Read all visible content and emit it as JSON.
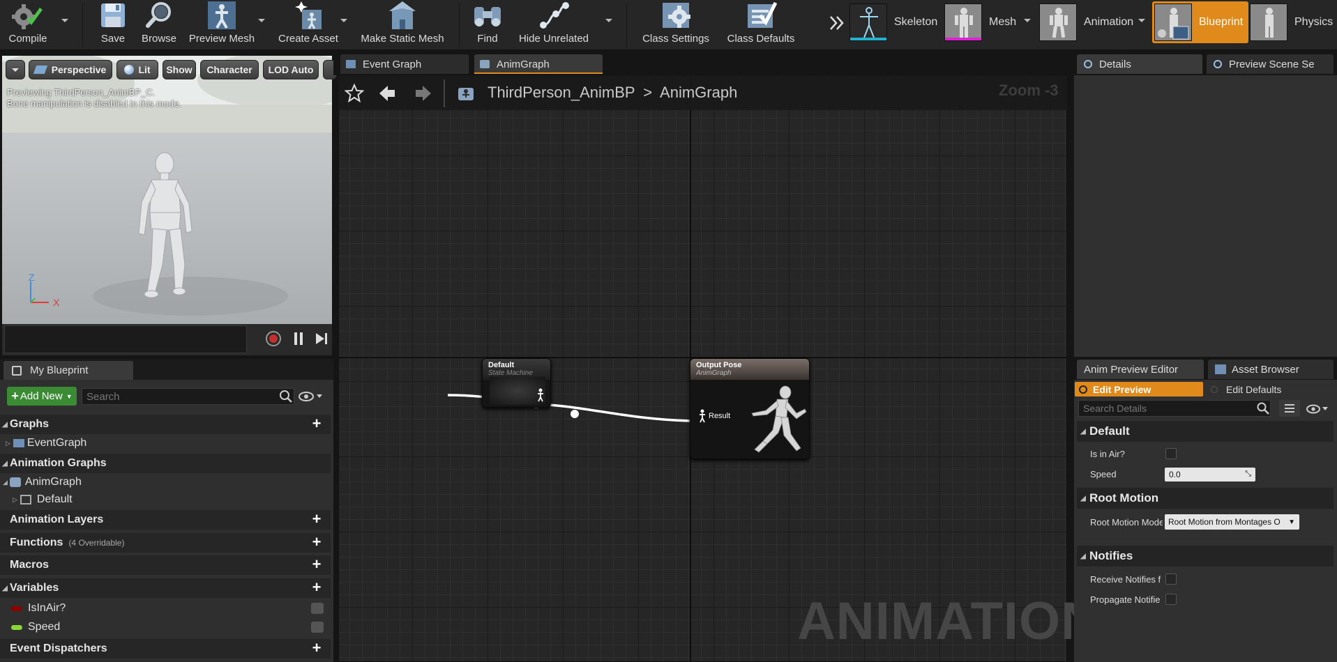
{
  "toolbar": {
    "compile": "Compile",
    "save": "Save",
    "browse": "Browse",
    "preview_mesh": "Preview Mesh",
    "create_asset": "Create Asset",
    "make_static_mesh": "Make Static Mesh",
    "find": "Find",
    "hide_unrelated": "Hide Unrelated",
    "class_settings": "Class Settings",
    "class_defaults": "Class Defaults"
  },
  "modes": {
    "skeleton": "Skeleton",
    "mesh": "Mesh",
    "animation": "Animation",
    "blueprint": "Blueprint",
    "physics": "Physics",
    "active": "Blueprint"
  },
  "viewport": {
    "perspective": "Perspective",
    "lit": "Lit",
    "show": "Show",
    "character": "Character",
    "lod": "LOD Auto",
    "message_line1": "Previewing ThirdPerson_AnimBP_C.",
    "message_line2": "Bone manipulation is disabled in this mode.",
    "axis_z": "Z",
    "axis_x": "X"
  },
  "my_blueprint": {
    "tab": "My Blueprint",
    "add_new": "Add New",
    "search_placeholder": "Search",
    "graphs": "Graphs",
    "event_graph": "EventGraph",
    "animation_graphs": "Animation Graphs",
    "anim_graph": "AnimGraph",
    "default": "Default",
    "animation_layers": "Animation Layers",
    "functions": "Functions",
    "functions_note": "(4 Overridable)",
    "macros": "Macros",
    "variables": "Variables",
    "var_is_in_air": "IsInAir?",
    "var_speed": "Speed",
    "event_dispatchers": "Event Dispatchers"
  },
  "graph": {
    "tab_event_graph": "Event Graph",
    "tab_anim_graph": "AnimGraph",
    "crumb_root": "ThirdPerson_AnimBP",
    "crumb_sep": ">",
    "crumb_current": "AnimGraph",
    "zoom": "Zoom -3",
    "watermark": "ANIMATION",
    "node_sm_title": "Default",
    "node_sm_sub": "State Machine",
    "node_out_title": "Output Pose",
    "node_out_sub": "AnimGraph",
    "node_out_pin": "Result"
  },
  "details": {
    "tab_details": "Details",
    "tab_preview_scene": "Preview Scene Se"
  },
  "anim_preview": {
    "tab_editor": "Anim Preview Editor",
    "tab_asset_browser": "Asset Browser",
    "edit_preview": "Edit Preview",
    "edit_defaults": "Edit Defaults",
    "search_placeholder": "Search Details",
    "section_default": "Default",
    "is_in_air_label": "Is in Air?",
    "speed_label": "Speed",
    "speed_value": "0.0",
    "section_root_motion": "Root Motion",
    "root_motion_label": "Root Motion Mode",
    "root_motion_value": "Root Motion from Montages O",
    "section_notifies": "Notifies",
    "receive_notifies_label": "Receive Notifies f",
    "propagate_notifies_label": "Propagate Notifie"
  },
  "colors": {
    "accent_orange": "#e08a1c",
    "add_new_green": "#3b8b35",
    "bool_var": "#8c0000",
    "float_var": "#8ad639"
  }
}
